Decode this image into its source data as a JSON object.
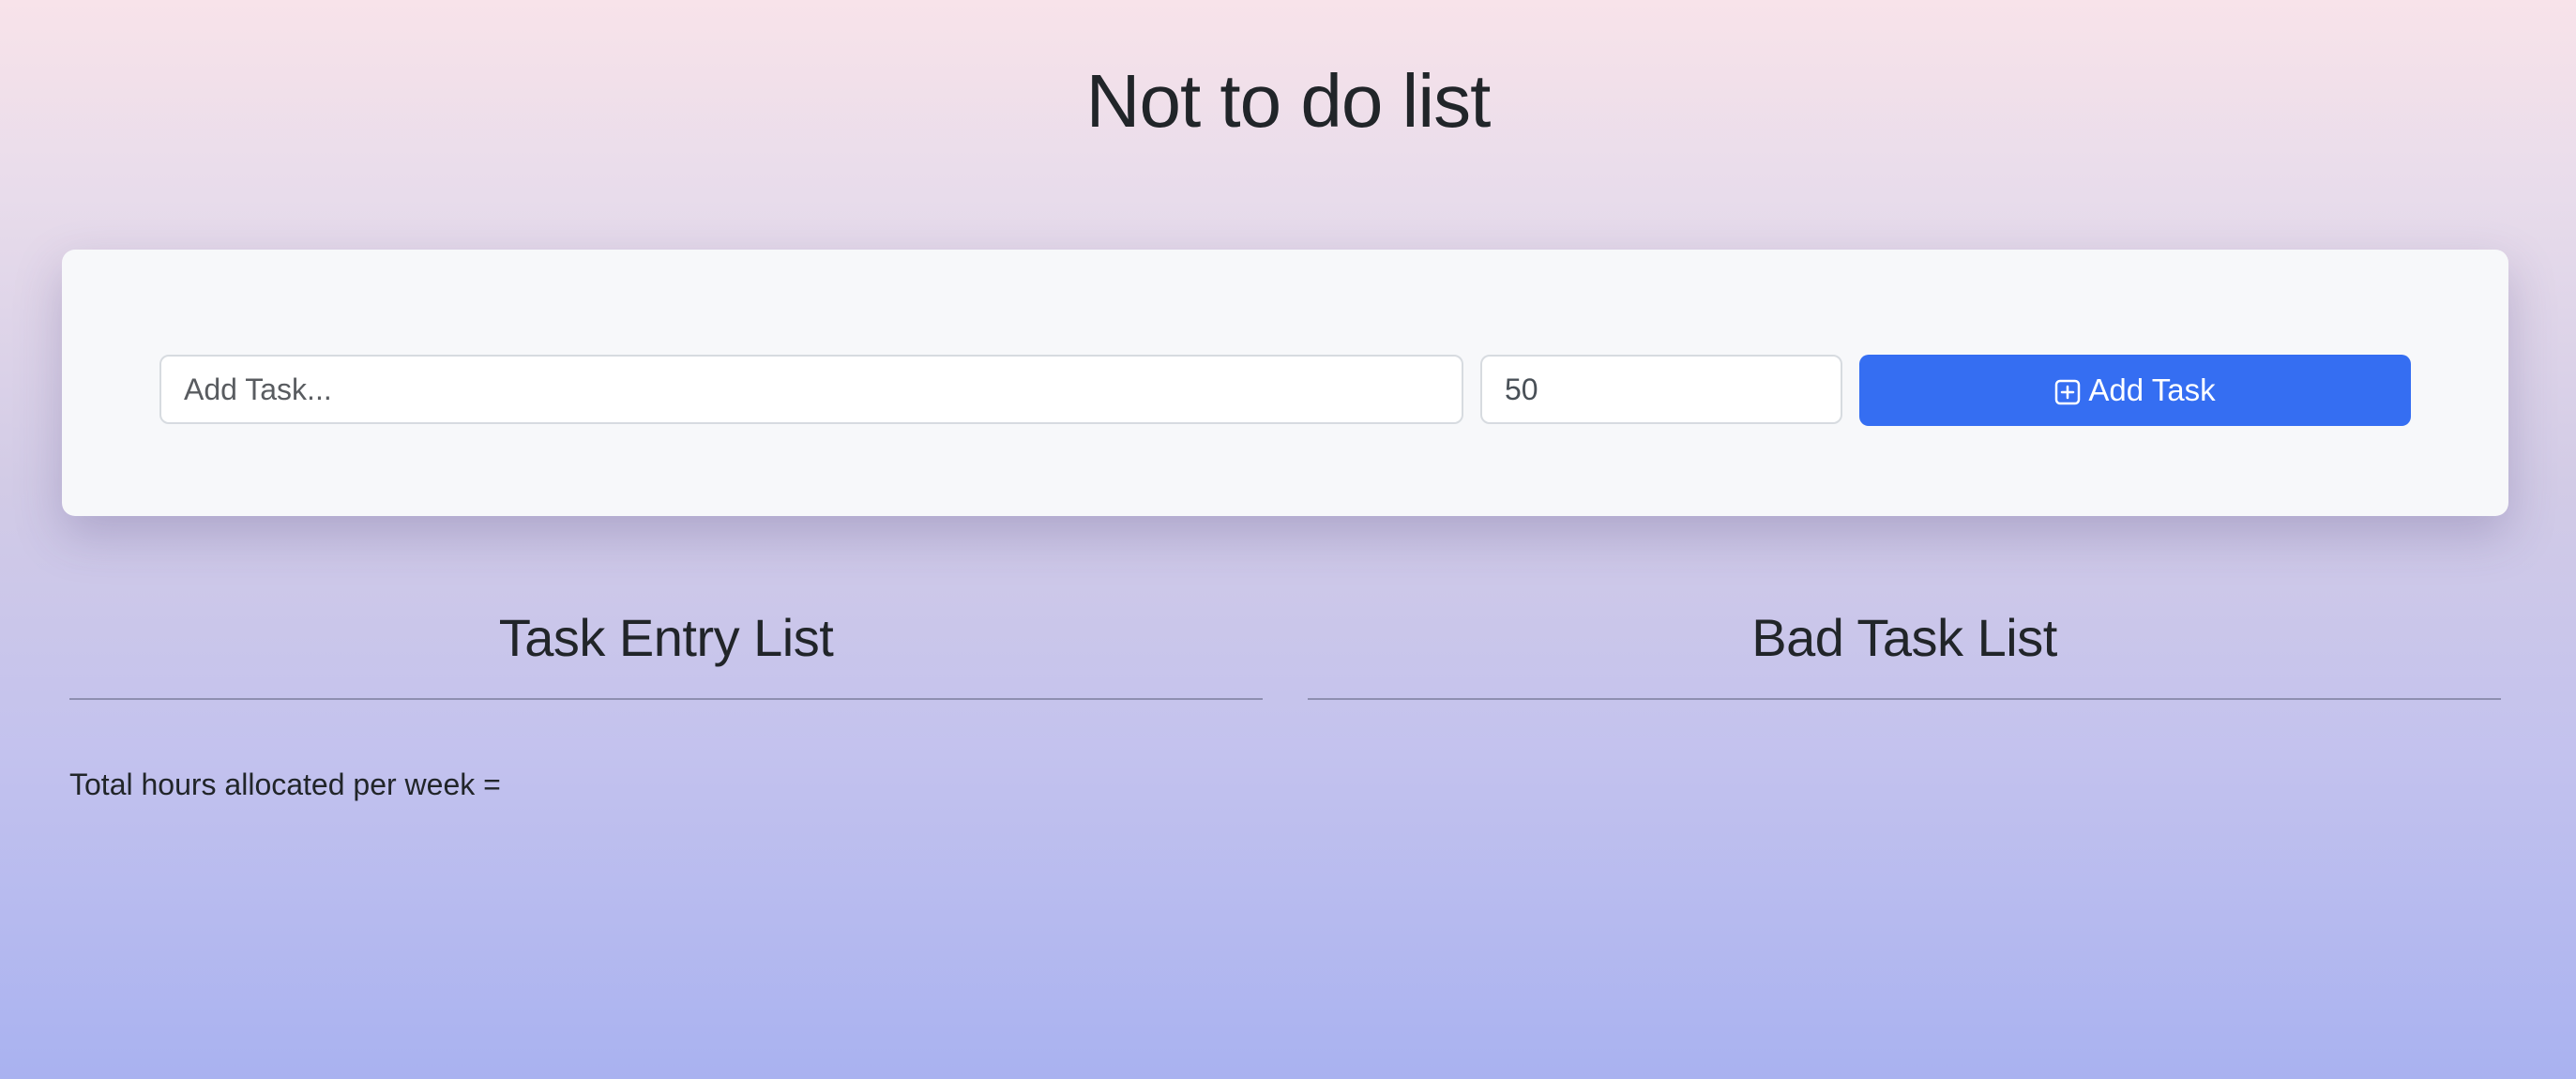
{
  "header": {
    "title": "Not to do list"
  },
  "form": {
    "task_placeholder": "Add Task...",
    "task_value": "",
    "hours_value": "50",
    "add_button_label": "Add Task",
    "add_button_icon": "plus-square-icon",
    "button_color": "#356ef2"
  },
  "lists": {
    "entry_title": "Task Entry List",
    "bad_title": "Bad Task List"
  },
  "summary": {
    "total_hours_label": "Total hours allocated per week ="
  }
}
